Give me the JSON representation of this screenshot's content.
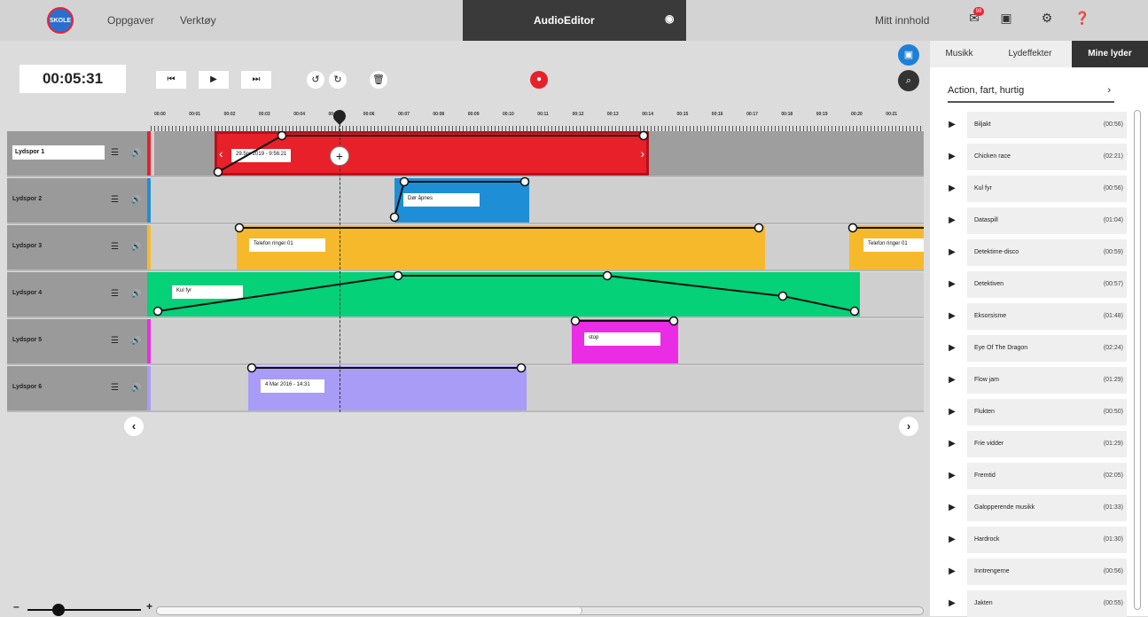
{
  "topbar": {
    "logo_text": "SKOLE",
    "menu": [
      "Oppgaver",
      "Verktøy"
    ],
    "center_title": "AudioEditor",
    "right_label": "Mitt innhold",
    "notification_count": "99"
  },
  "toolbar": {
    "time": "00:05:31"
  },
  "ruler": {
    "ticks": [
      "00:00",
      "00:01",
      "00:02",
      "00:03",
      "00:04",
      "00:05",
      "00:06",
      "00:07",
      "00:08",
      "00:09",
      "00:10",
      "00:11",
      "00:12",
      "00:13",
      "00:14",
      "00:15",
      "00:16",
      "00:17",
      "00:18",
      "00:19",
      "00:20",
      "00:21"
    ]
  },
  "tracks": [
    {
      "name": "Lydspor 1",
      "color": "#e8202a",
      "clips": [
        {
          "label": "29.5pr 2019 - 9:56:21"
        }
      ]
    },
    {
      "name": "Lydspor 2",
      "color": "#1e8fd6",
      "clips": [
        {
          "label": "Dør åpnes"
        }
      ]
    },
    {
      "name": "Lydspor 3",
      "color": "#f7b92c",
      "clips": [
        {
          "label": "Telefon ringer 01"
        },
        {
          "label": "Telefon ringer 01"
        }
      ]
    },
    {
      "name": "Lydspor 4",
      "color": "#04d178",
      "clips": [
        {
          "label": "Kul fyr"
        }
      ]
    },
    {
      "name": "Lydspor 5",
      "color": "#ea2ce4",
      "clips": [
        {
          "label": "stop"
        }
      ]
    },
    {
      "name": "Lydspor 6",
      "color": "#a99cf6",
      "clips": [
        {
          "label": "4 Mar 2016 - 14:31"
        }
      ]
    }
  ],
  "panel": {
    "tabs": [
      "Musikk",
      "Lydeffekter",
      "Mine lyder"
    ],
    "active_tab": "Mine lyder",
    "genre": "Action, fart, hurtig",
    "sounds": [
      {
        "name": "Biljakt",
        "duration": "(00:56)"
      },
      {
        "name": "Chicken race",
        "duration": "(02:21)"
      },
      {
        "name": "Kul fyr",
        "duration": "(00:56)"
      },
      {
        "name": "Dataspill",
        "duration": "(01:04)"
      },
      {
        "name": "Detektime-disco",
        "duration": "(00:59)"
      },
      {
        "name": "Detektiven",
        "duration": "(00:57)"
      },
      {
        "name": "Eksorsisme",
        "duration": "(01:48)"
      },
      {
        "name": "Eye Of The Dragon",
        "duration": "(02:24)"
      },
      {
        "name": "Flow jam",
        "duration": "(01:29)"
      },
      {
        "name": "Flukten",
        "duration": "(00:50)"
      },
      {
        "name": "Frie vidder",
        "duration": "(01:29)"
      },
      {
        "name": "Fremtid",
        "duration": "(02:05)"
      },
      {
        "name": "Galopperende musikk",
        "duration": "(01:33)"
      },
      {
        "name": "Hardrock",
        "duration": "(01:30)"
      },
      {
        "name": "Inntrengerne",
        "duration": "(00:56)"
      },
      {
        "name": "Jakten",
        "duration": "(00:55)"
      }
    ]
  }
}
